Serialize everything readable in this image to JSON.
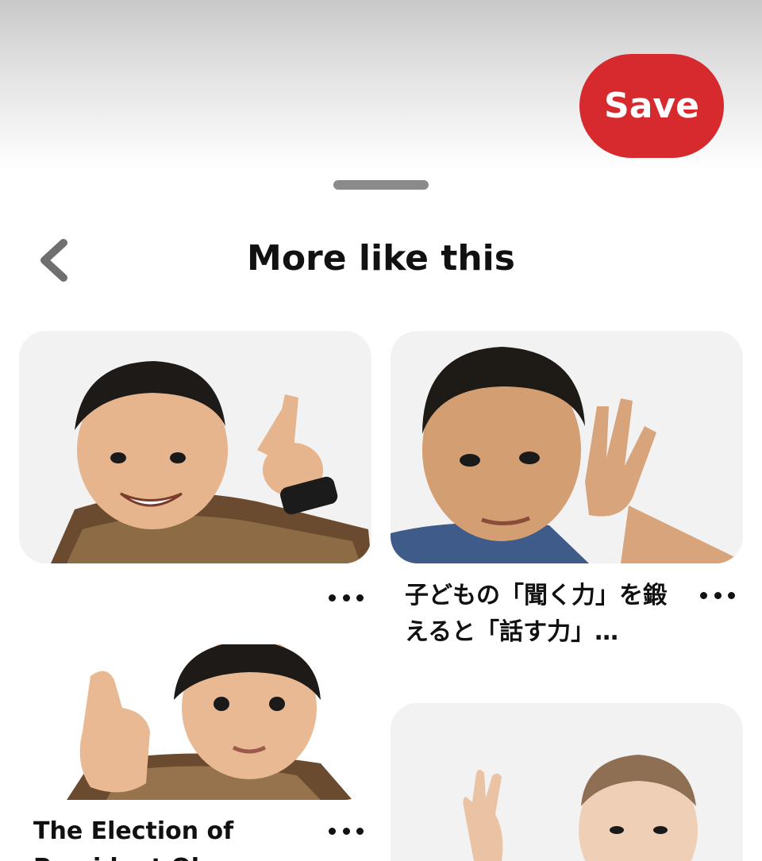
{
  "header": {
    "save_label": "Save"
  },
  "sheet": {
    "title": "More like this",
    "back_icon": "chevron-left-icon"
  },
  "pins": [
    {
      "caption": "",
      "more_icon": "more-horizontal-icon"
    },
    {
      "caption": "子どもの「聞く力」を鍛えると「話す力」…",
      "more_icon": "more-horizontal-icon"
    },
    {
      "caption": "The Election of President Obama",
      "more_icon": "more-horizontal-icon"
    },
    {
      "caption": "",
      "more_icon": "more-horizontal-icon"
    }
  ],
  "colors": {
    "accent": "#d62a2f",
    "text": "#111111",
    "handle": "#8a8a8a"
  }
}
